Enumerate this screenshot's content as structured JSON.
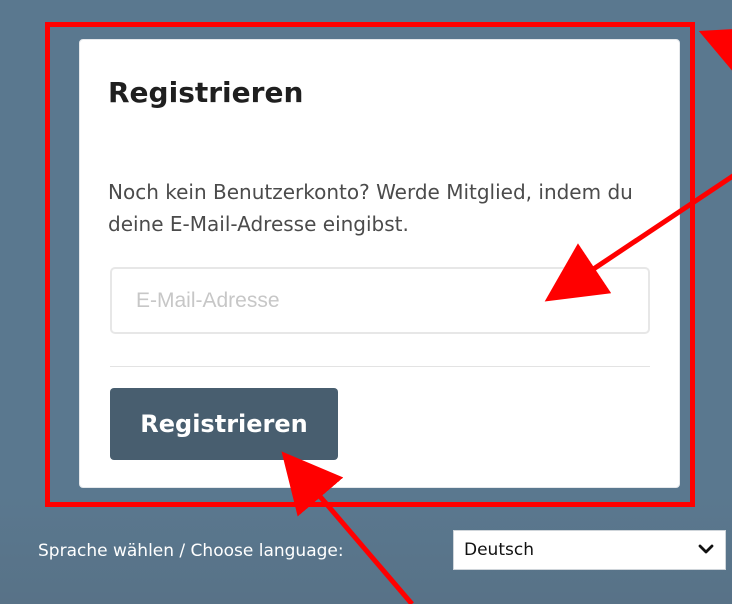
{
  "registration": {
    "title": "Registrieren",
    "description": "Noch kein Benutzerkonto? Werde Mitglied, indem du deine E-Mail-Adresse eingibst.",
    "email_placeholder": "E-Mail-Adresse",
    "email_value": "",
    "submit_label": "Registrieren"
  },
  "language": {
    "label": "Sprache wählen / Choose language:",
    "selected": "Deutsch"
  },
  "annotations": {
    "color": "#ff0000",
    "marker": "red-arrow-icon"
  }
}
